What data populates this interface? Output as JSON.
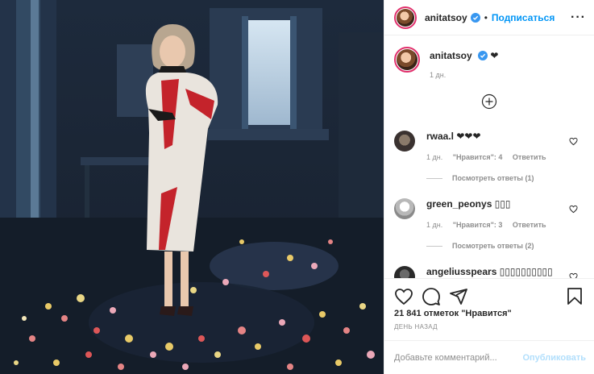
{
  "post": {
    "username": "anitatsoy",
    "follow_label": "Подписаться",
    "dot": "•",
    "more": "···"
  },
  "caption": {
    "username": "anitatsoy",
    "text": "❤",
    "time": "1 дн."
  },
  "comments": [
    {
      "username": "rwaa.l",
      "text": "❤❤❤",
      "time": "1 дн.",
      "likes": "\"Нравится\": 4",
      "reply": "Ответить",
      "replies": "Посмотреть ответы (1)"
    },
    {
      "username": "green_peonys",
      "text": "▯▯▯",
      "time": "1 дн.",
      "likes": "\"Нравится\": 3",
      "reply": "Ответить",
      "replies": "Посмотреть ответы (2)"
    },
    {
      "username": "angeliusspears",
      "text": "▯▯▯▯▯▯▯▯▯▯"
    }
  ],
  "likes": {
    "count": "21 841 отметок",
    "label": "\"Нравится\""
  },
  "date": "День назад",
  "add_comment": {
    "placeholder": "Добавьте комментарий...",
    "publish": "Опубликовать"
  },
  "colors": {
    "accent": "#0095f6",
    "publish_disabled": "#b2dffc",
    "muted": "#8e8e8e",
    "border": "#efefef"
  },
  "icons": [
    "verified-icon",
    "more-options-icon",
    "load-more-icon",
    "heart-icon",
    "comment-icon",
    "share-icon",
    "save-icon"
  ]
}
